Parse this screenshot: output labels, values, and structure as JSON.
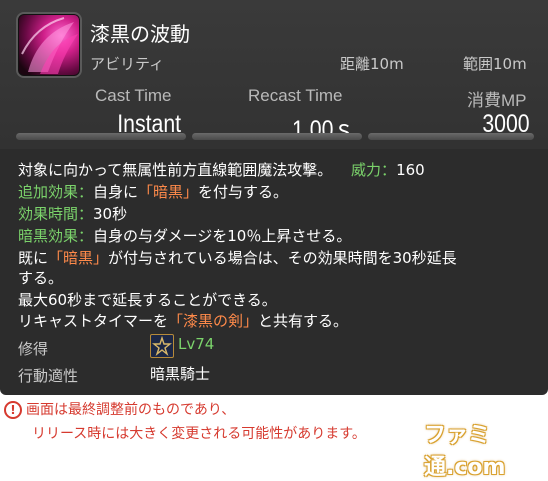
{
  "skill": {
    "name": "漆黒の波動",
    "type": "アビリティ",
    "distance_label": "距離10m",
    "range_label": "範囲10m"
  },
  "stats": {
    "cast_label": "Cast Time",
    "cast_value": "Instant",
    "recast_label": "Recast Time",
    "recast_value": "1.00ｓ",
    "cost_label": "消費MP",
    "cost_value": "3000"
  },
  "description": {
    "line1": "対象に向かって無属性前方直線範囲魔法攻撃。",
    "potency_label": "威力：",
    "potency_value": "160",
    "add_effect_label": "追加効果：",
    "add_effect_pre": "自身に",
    "darkness": "「暗黒」",
    "add_effect_post": "を付与する。",
    "duration_label": "効果時間：",
    "duration_value": "30秒",
    "dark_effect_label": "暗黒効果：",
    "dark_effect_value": "自身の与ダメージを10％上昇させる。",
    "line5_pre": "既に",
    "line5_post": "が付与されている場合は、その効果時間を30秒延長",
    "line6": "する。",
    "line7": "最大60秒まで延長することができる。",
    "line8_pre": "リキャストタイマーを",
    "shared_skill": "「漆黒の剣」",
    "line8_post": "と共有する。"
  },
  "meta": {
    "acquired_label": "修得",
    "level": "Lv74",
    "class_label": "行動適性",
    "class_value": "暗黒騎士"
  },
  "footer": {
    "warning_symbol": "!",
    "note_line1": "画面は最終調整前のものであり、",
    "note_line2": "リリース時には大きく変更される可能性があります。",
    "logo_text": "ファミ通.com"
  },
  "colors": {
    "green": "#7bd36b",
    "orange": "#ff8a4a",
    "warning_red": "#d63a2f"
  },
  "icons": [
    "skill-icon",
    "dark-knight-job-icon",
    "warning-icon"
  ]
}
